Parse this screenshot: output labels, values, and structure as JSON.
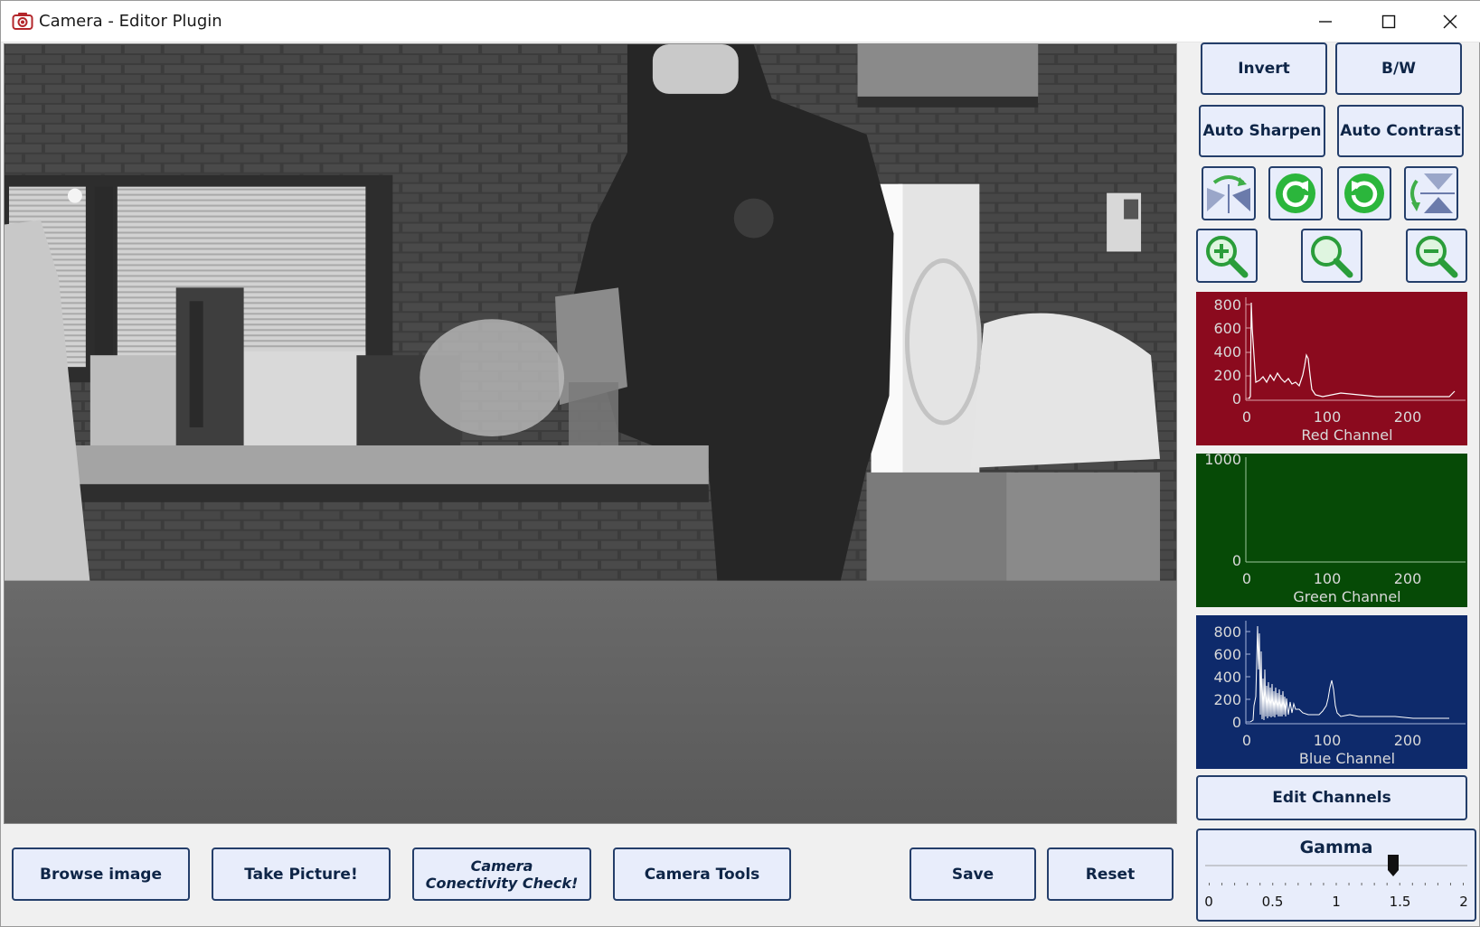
{
  "window": {
    "title": "Camera - Editor Plugin",
    "controls": [
      "minimize",
      "maximize",
      "close"
    ]
  },
  "toolbar_right": {
    "invert": "Invert",
    "bw": "B/W",
    "auto_sharpen": "Auto Sharpen",
    "auto_contrast": "Auto Contrast",
    "icons": [
      "flip-horizontal-icon",
      "rotate-clockwise-icon",
      "rotate-counterclockwise-icon",
      "flip-vertical-icon",
      "zoom-in-icon",
      "zoom-reset-icon",
      "zoom-out-icon"
    ]
  },
  "histograms": {
    "red": {
      "title": "Red Channel",
      "yticks": [
        "800",
        "600",
        "400",
        "200",
        "0"
      ],
      "xticks": [
        "0",
        "100",
        "200"
      ],
      "bg": "#8b0a1e"
    },
    "green": {
      "title": "Green Channel",
      "yticks": [
        "1000",
        "0"
      ],
      "xticks": [
        "0",
        "100",
        "200"
      ],
      "bg": "#064a06"
    },
    "blue": {
      "title": "Blue Channel",
      "yticks": [
        "800",
        "600",
        "400",
        "200",
        "0"
      ],
      "xticks": [
        "0",
        "100",
        "200"
      ],
      "bg": "#0e2a6b"
    }
  },
  "edit_channels": "Edit Channels",
  "gamma": {
    "title": "Gamma",
    "value": 1.45,
    "min": 0,
    "max": 2,
    "labels": [
      "0",
      "0.5",
      "1",
      "1.5",
      "2"
    ]
  },
  "bottom_bar": {
    "browse": "Browse image",
    "take_picture": "Take Picture!",
    "connectivity_line1": "Camera",
    "connectivity_line2": "Conectivity Check!",
    "camera_tools": "Camera Tools",
    "save": "Save",
    "reset": "Reset"
  }
}
